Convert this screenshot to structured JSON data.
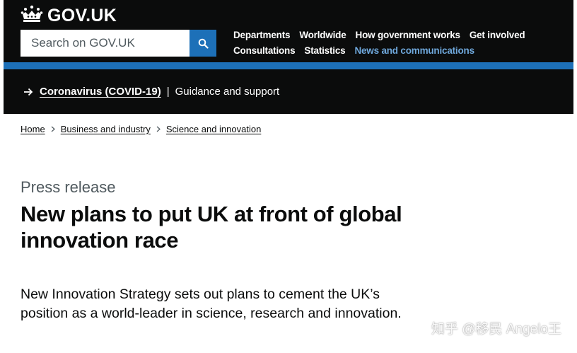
{
  "header": {
    "logo_text": "GOV.UK",
    "search": {
      "placeholder": "Search on GOV.UK",
      "button_icon": "magnifying-glass-icon"
    },
    "nav_row_1": [
      "Departments",
      "Worldwide",
      "How government works",
      "Get involved"
    ],
    "nav_row_2": [
      "Consultations",
      "Statistics",
      "News and communications"
    ],
    "active_nav": "News and communications"
  },
  "banner": {
    "link_text": "Coronavirus (COVID-19)",
    "separator": "|",
    "text": "Guidance and support"
  },
  "breadcrumb": [
    "Home",
    "Business and industry",
    "Science and innovation"
  ],
  "article": {
    "caption": "Press release",
    "title": "New plans to put UK at front of global innovation race",
    "lede": "New Innovation Strategy sets out plans to cement the UK’s position as a world-leader in science, research and innovation."
  },
  "watermark": "知乎 @移民 Angelo王",
  "colors": {
    "header_bg": "#0b0c0c",
    "brand_blue": "#1d70b8",
    "active_link": "#6fa8dc",
    "secondary_text": "#505a5f"
  }
}
